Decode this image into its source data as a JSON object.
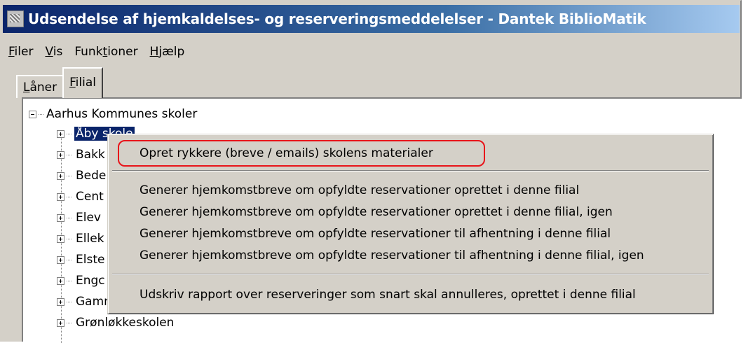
{
  "window": {
    "title": "Udsendelse af hjemkaldelses- og reserveringsmeddelelser - Dantek BiblioMatik",
    "icon": "app-icon"
  },
  "menubar": {
    "items": [
      {
        "accel": "F",
        "rest": "iler"
      },
      {
        "accel": "V",
        "rest": "is"
      },
      {
        "pre": "Funk",
        "accel": "t",
        "rest": "ioner"
      },
      {
        "accel": "H",
        "rest": "jælp"
      }
    ]
  },
  "tabs": [
    {
      "accel": "L",
      "rest": "åner",
      "active": false
    },
    {
      "accel": "F",
      "rest": "ilial",
      "active": true
    }
  ],
  "tree": {
    "root": "Aarhus Kommunes skoler",
    "children": [
      "Åby skole",
      "Bakk",
      "Bede",
      "Cent",
      "Elev",
      "Ellek",
      "Elste",
      "Engc",
      "Gammelgårdskolen",
      "Grønløkkeskolen"
    ],
    "selected_index": 0
  },
  "context_menu": {
    "items": [
      "Opret rykkere (breve / emails) skolens materialer",
      "Generer hjemkomstbreve om opfyldte reservationer oprettet i denne filial",
      "Generer hjemkomstbreve om opfyldte reservationer oprettet i denne filial, igen",
      "Generer hjemkomstbreve om opfyldte reservationer til afhentning i denne filial",
      "Generer hjemkomstbreve om opfyldte reservationer til afhentning i denne filial, igen",
      "Udskriv rapport over reserveringer som snart skal annulleres, oprettet i denne filial"
    ],
    "highlight_color": "#e8141a"
  }
}
